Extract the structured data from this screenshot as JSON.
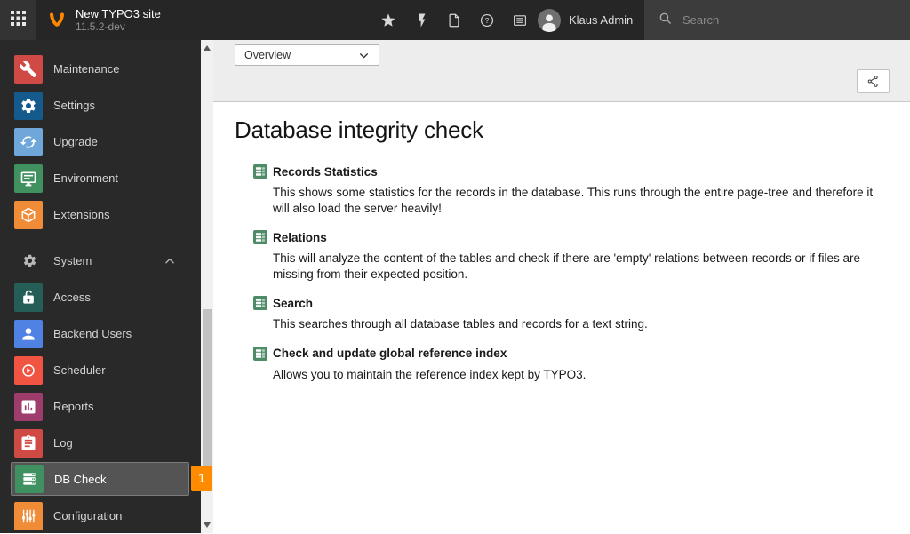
{
  "topbar": {
    "app_title": "New TYPO3 site",
    "app_version": "11.5.2-dev",
    "user_name": "Klaus Admin",
    "search_placeholder": "Search",
    "colors": {
      "bar": "#262626",
      "search_area": "#3c3c3c",
      "logo": "#ff8700"
    }
  },
  "sidebar": {
    "colors": {
      "bg": "#292929",
      "selected_bg": "#545454",
      "badge": "#ff8c00"
    },
    "admin_items": [
      {
        "label": "Maintenance",
        "icon": "wrench-icon",
        "color": "#cf4a45"
      },
      {
        "label": "Settings",
        "icon": "gear-icon",
        "color": "#155a8c"
      },
      {
        "label": "Upgrade",
        "icon": "refresh-icon",
        "color": "#6fa7da"
      },
      {
        "label": "Environment",
        "icon": "monitor-icon",
        "color": "#40915f"
      },
      {
        "label": "Extensions",
        "icon": "cube-icon",
        "color": "#f08b38"
      }
    ],
    "system_section_label": "System",
    "system_items": [
      {
        "label": "Access",
        "icon": "unlock-icon",
        "color": "#255e56"
      },
      {
        "label": "Backend Users",
        "icon": "user-icon",
        "color": "#4f82e2"
      },
      {
        "label": "Scheduler",
        "icon": "play-circle-icon",
        "color": "#f25444"
      },
      {
        "label": "Reports",
        "icon": "chart-doc-icon",
        "color": "#9e3d6b"
      },
      {
        "label": "Log",
        "icon": "clipboard-icon",
        "color": "#cf4a45"
      },
      {
        "label": "DB Check",
        "icon": "database-icon",
        "color": "#3f9162",
        "selected": true,
        "badge": "1"
      },
      {
        "label": "Configuration",
        "icon": "sliders-icon",
        "color": "#f08b38"
      }
    ]
  },
  "docheader": {
    "module_dropdown_value": "Overview"
  },
  "content": {
    "title": "Database integrity check",
    "items": [
      {
        "title": "Records Statistics",
        "description": "This shows some statistics for the records in the database. This runs through the entire page-tree and therefore it will also load the server heavily!"
      },
      {
        "title": "Relations",
        "description": "This will analyze the content of the tables and check if there are 'empty' relations between records or if files are missing from their expected position."
      },
      {
        "title": "Search",
        "description": "This searches through all database tables and records for a text string."
      },
      {
        "title": "Check and update global reference index",
        "description": "Allows you to maintain the reference index kept by TYPO3."
      }
    ]
  }
}
